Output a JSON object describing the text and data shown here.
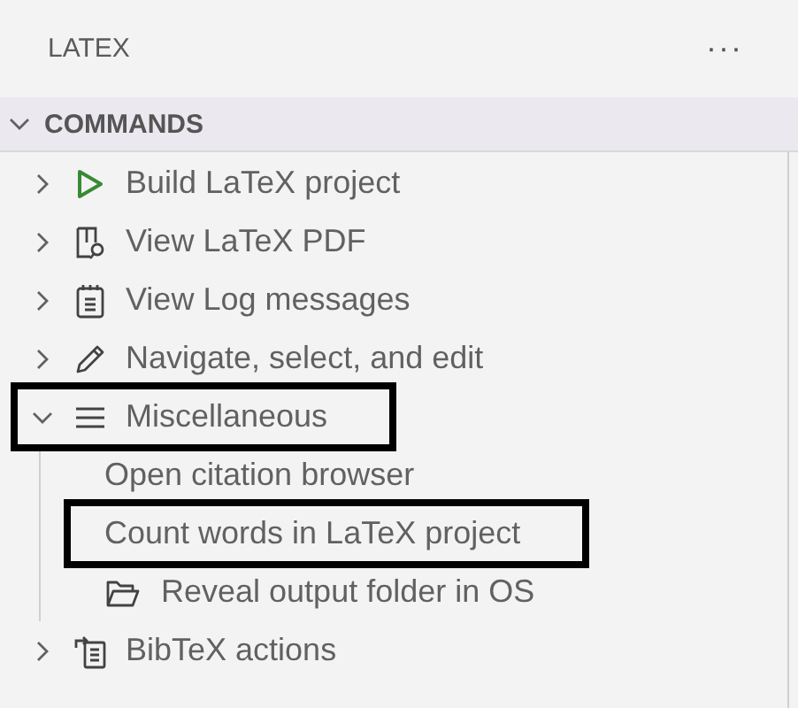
{
  "panel": {
    "title": "LATEX",
    "more": "···"
  },
  "section": {
    "title": "COMMANDS",
    "expanded": true,
    "items": [
      {
        "label": "Build LaTeX project",
        "expanded": false,
        "highlighted": false
      },
      {
        "label": "View LaTeX PDF",
        "expanded": false,
        "highlighted": false
      },
      {
        "label": "View Log messages",
        "expanded": false,
        "highlighted": false
      },
      {
        "label": "Navigate, select, and edit",
        "expanded": false,
        "highlighted": false
      },
      {
        "label": "Miscellaneous",
        "expanded": true,
        "highlighted": true,
        "children": [
          {
            "label": "Open citation browser",
            "highlighted": false
          },
          {
            "label": "Count words in LaTeX project",
            "highlighted": true
          },
          {
            "label": "Reveal output folder in OS",
            "highlighted": false
          }
        ]
      },
      {
        "label": "BibTeX actions",
        "expanded": false,
        "highlighted": false
      }
    ]
  }
}
